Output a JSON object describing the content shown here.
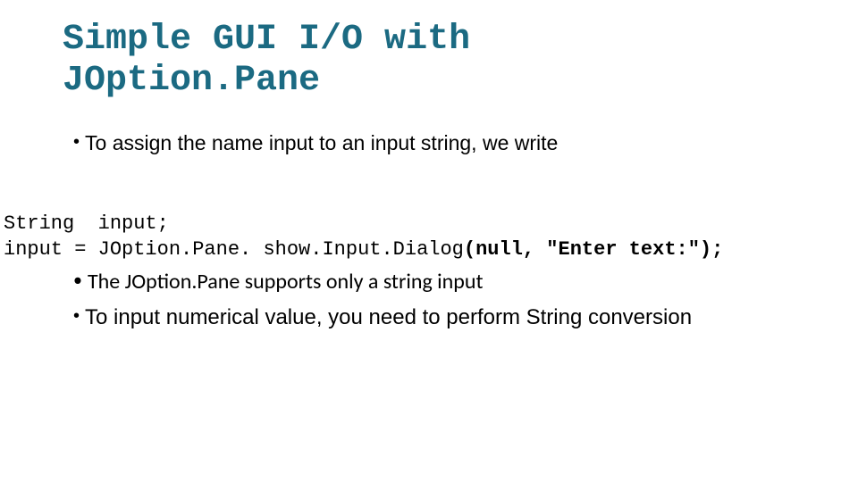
{
  "title_line1": "Simple GUI I/O with",
  "title_line2": "JOption.Pane",
  "bullet1": "To assign the name input to an input string, we write",
  "code_line1": "String  input;",
  "code_line2_plain": "input = JOption.Pane. show.Input.Dialog",
  "code_line2_bold": "(null, \"Enter text:\");",
  "bullet2": "The JOption.Pane supports only a string input",
  "bullet3": "To input numerical value, you need to perform String conversion"
}
